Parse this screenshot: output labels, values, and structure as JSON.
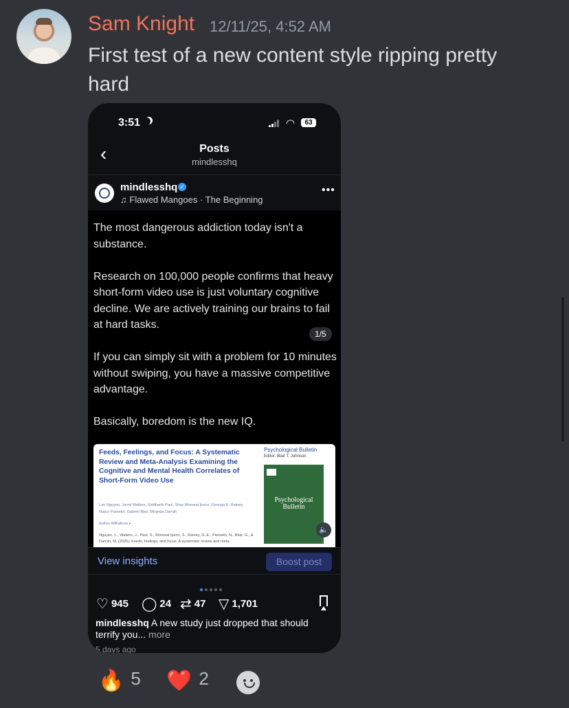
{
  "message": {
    "author": "Sam Knight",
    "timestamp": "12/11/25, 4:52 AM",
    "text": "First test of a new content style ripping pretty hard"
  },
  "phone": {
    "status_time": "3:51",
    "battery": "63",
    "nav_title": "Posts",
    "nav_subtitle": "mindlesshq",
    "post": {
      "username": "mindlesshq",
      "music": "Flawed Mangoes · The Beginning",
      "slide_counter": "1/5",
      "paragraphs": [
        "The most dangerous addiction today isn't a substance.",
        "Research on 100,000 people confirms that heavy short-form video use is just voluntary cognitive decline. We are actively training our brains to fail at hard tasks.",
        "If you can simply sit with a problem for 10 minutes without swiping, you have a massive competitive advantage.",
        "Basically, boredom is the new IQ."
      ],
      "paper": {
        "title": "Feeds, Feelings, and Focus: A Systematic Review and Meta-Analysis Examining the Cognitive and Mental Health Correlates of Short-Form Video Use",
        "authors": "Lan Nguyen, Jared Walters, Siddharth Paul, Shay Monreal Ijurco, Georgia E. Rainey, Nupur Pareekh, Gabriel Blair, Miranda Darrah",
        "affiliations": "Author Affiliations ▸",
        "citation": "Nguyen, L., Walters, J., Paul, S., Monreal Ijurco, S., Rainey, G. E., Pareekh, N., Blair, G., & Darrah, M. (2025). Feeds, feelings, and focus: A systematic review and meta-",
        "journal": "Psychological Bulletin",
        "editor": "Editor: Blair T. Johnson",
        "cover_title": "Psychological Bulletin"
      },
      "view_insights": "View insights",
      "boost_post": "Boost post",
      "likes": "945",
      "comments": "24",
      "reposts": "47",
      "shares": "1,701",
      "caption_user": "mindlesshq",
      "caption_text": " A new study just dropped that should terrify you... ",
      "caption_more": "more",
      "date": "5 days ago"
    }
  },
  "reactions": [
    {
      "emoji": "🔥",
      "count": "5"
    },
    {
      "emoji": "❤️",
      "count": "2"
    }
  ],
  "colors": {
    "background": "#323339",
    "username": "#f2735a",
    "accent_link": "#8bb1ff"
  }
}
